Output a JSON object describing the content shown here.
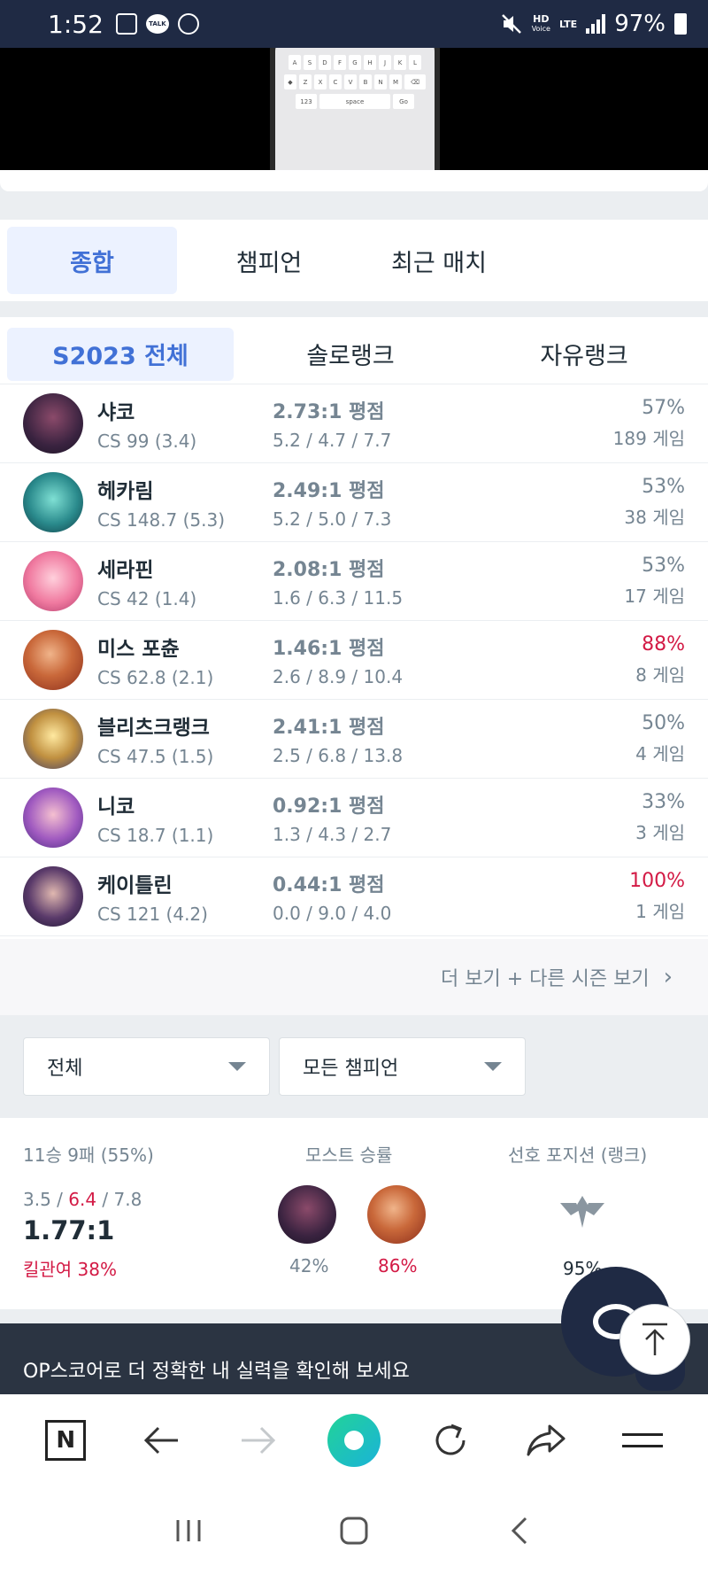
{
  "status_bar": {
    "time": "1:52",
    "talk_label": "TALK",
    "hd_label": "HD",
    "voice_label": "Voice",
    "lte_label": "LTE",
    "battery": "97%"
  },
  "keyboard": {
    "row1": [
      "A",
      "S",
      "D",
      "F",
      "G",
      "H",
      "J",
      "K",
      "L"
    ],
    "row2": [
      "Z",
      "X",
      "C",
      "V",
      "B",
      "N",
      "M"
    ],
    "num_key": "123",
    "space_key": "space",
    "go_key": "Go"
  },
  "tabs": [
    "종합",
    "챔피언",
    "최근 매치"
  ],
  "subtabs": [
    "S2023 전체",
    "솔로랭크",
    "자유랭크"
  ],
  "champions": [
    {
      "name": "샤코",
      "cs": "CS 99 (3.4)",
      "kda_ratio": "2.73:1 평점",
      "kda": "5.2 / 4.7 / 7.7",
      "winrate": "57%",
      "games": "189 게임",
      "hot": false
    },
    {
      "name": "헤카림",
      "cs": "CS 148.7 (5.3)",
      "kda_ratio": "2.49:1 평점",
      "kda": "5.2 / 5.0 / 7.3",
      "winrate": "53%",
      "games": "38 게임",
      "hot": false
    },
    {
      "name": "세라핀",
      "cs": "CS 42 (1.4)",
      "kda_ratio": "2.08:1 평점",
      "kda": "1.6 / 6.3 / 11.5",
      "winrate": "53%",
      "games": "17 게임",
      "hot": false
    },
    {
      "name": "미스 포츈",
      "cs": "CS 62.8 (2.1)",
      "kda_ratio": "1.46:1 평점",
      "kda": "2.6 / 8.9 / 10.4",
      "winrate": "88%",
      "games": "8 게임",
      "hot": true
    },
    {
      "name": "블리츠크랭크",
      "cs": "CS 47.5 (1.5)",
      "kda_ratio": "2.41:1 평점",
      "kda": "2.5 / 6.8 / 13.8",
      "winrate": "50%",
      "games": "4 게임",
      "hot": false
    },
    {
      "name": "니코",
      "cs": "CS 18.7 (1.1)",
      "kda_ratio": "0.92:1 평점",
      "kda": "1.3 / 4.3 / 2.7",
      "winrate": "33%",
      "games": "3 게임",
      "hot": false
    },
    {
      "name": "케이틀린",
      "cs": "CS 121 (4.2)",
      "kda_ratio": "0.44:1 평점",
      "kda": "0.0 / 9.0 / 4.0",
      "winrate": "100%",
      "games": "1 게임",
      "hot": true
    }
  ],
  "more_link": "더 보기 + 다른 시즌 보기",
  "filters": {
    "queue": "전체",
    "champion": "모든 챔피언"
  },
  "summary": {
    "record": "11승 9패 (55%)",
    "kills": "3.5",
    "deaths": "6.4",
    "assists": "7.8",
    "kda_ratio": "1.77:1",
    "kill_participation": "킬관여 38%",
    "most_winrate_label": "모스트 승률",
    "most": [
      {
        "pct": "42%"
      },
      {
        "pct": "86%"
      }
    ],
    "position_label": "선호 포지션 (랭크)",
    "position_pct": "95%"
  },
  "banner_text": "OP스코어로 더 정확한 내 실력을 확인해 보세요",
  "toolbar": {
    "n_label": "N"
  },
  "colors": {
    "accent": "#4171d6",
    "hot": "#d31a45",
    "muted": "#758592",
    "statusbar": "#1f2a44"
  }
}
